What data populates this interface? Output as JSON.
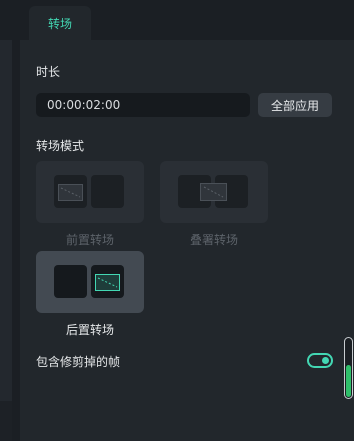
{
  "tab": {
    "label": "转场"
  },
  "duration": {
    "label": "时长",
    "value": "00:00:02:00"
  },
  "apply_all_label": "全部应用",
  "mode": {
    "label": "转场模式",
    "options": [
      {
        "label": "前置转场",
        "state": "disabled"
      },
      {
        "label": "叠署转场",
        "state": "disabled"
      },
      {
        "label": "后置转场",
        "state": "selected"
      }
    ]
  },
  "include_trimmed": {
    "label": "包含修剪掉的帧",
    "enabled": true
  },
  "colors": {
    "accent": "#43d7b3",
    "scroll_thumb": "#2fbf6a"
  }
}
